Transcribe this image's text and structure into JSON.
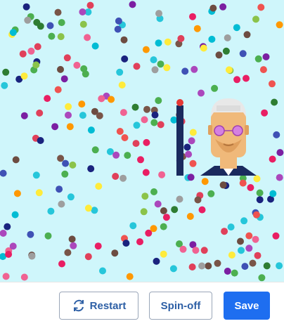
{
  "canvas": {
    "background": "#cff6fb",
    "dot_colors": [
      "#e0405a",
      "#2e7d32",
      "#7b1fa2",
      "#f06292",
      "#3f51b5",
      "#00bcd4",
      "#8bc34a",
      "#ff9800",
      "#795548",
      "#9e9e9e",
      "#1a237e",
      "#4caf50",
      "#e91e63",
      "#26c6da",
      "#6d4c41",
      "#ab47bc",
      "#ffeb3b",
      "#ef5350"
    ],
    "pole_color": "#1a2a5e",
    "pole_tip_color": "#e53935",
    "character": {
      "skin": "#f0b97a",
      "hair": "#e8e8e8",
      "glasses": "#d580e0",
      "suit": "#1a2a5e"
    }
  },
  "toolbar": {
    "restart_label": "Restart",
    "spinoff_label": "Spin-off",
    "save_label": "Save",
    "restart_icon": "refresh-icon",
    "accent": "#1e6ef0",
    "secondary_text": "#2d5fa5"
  }
}
